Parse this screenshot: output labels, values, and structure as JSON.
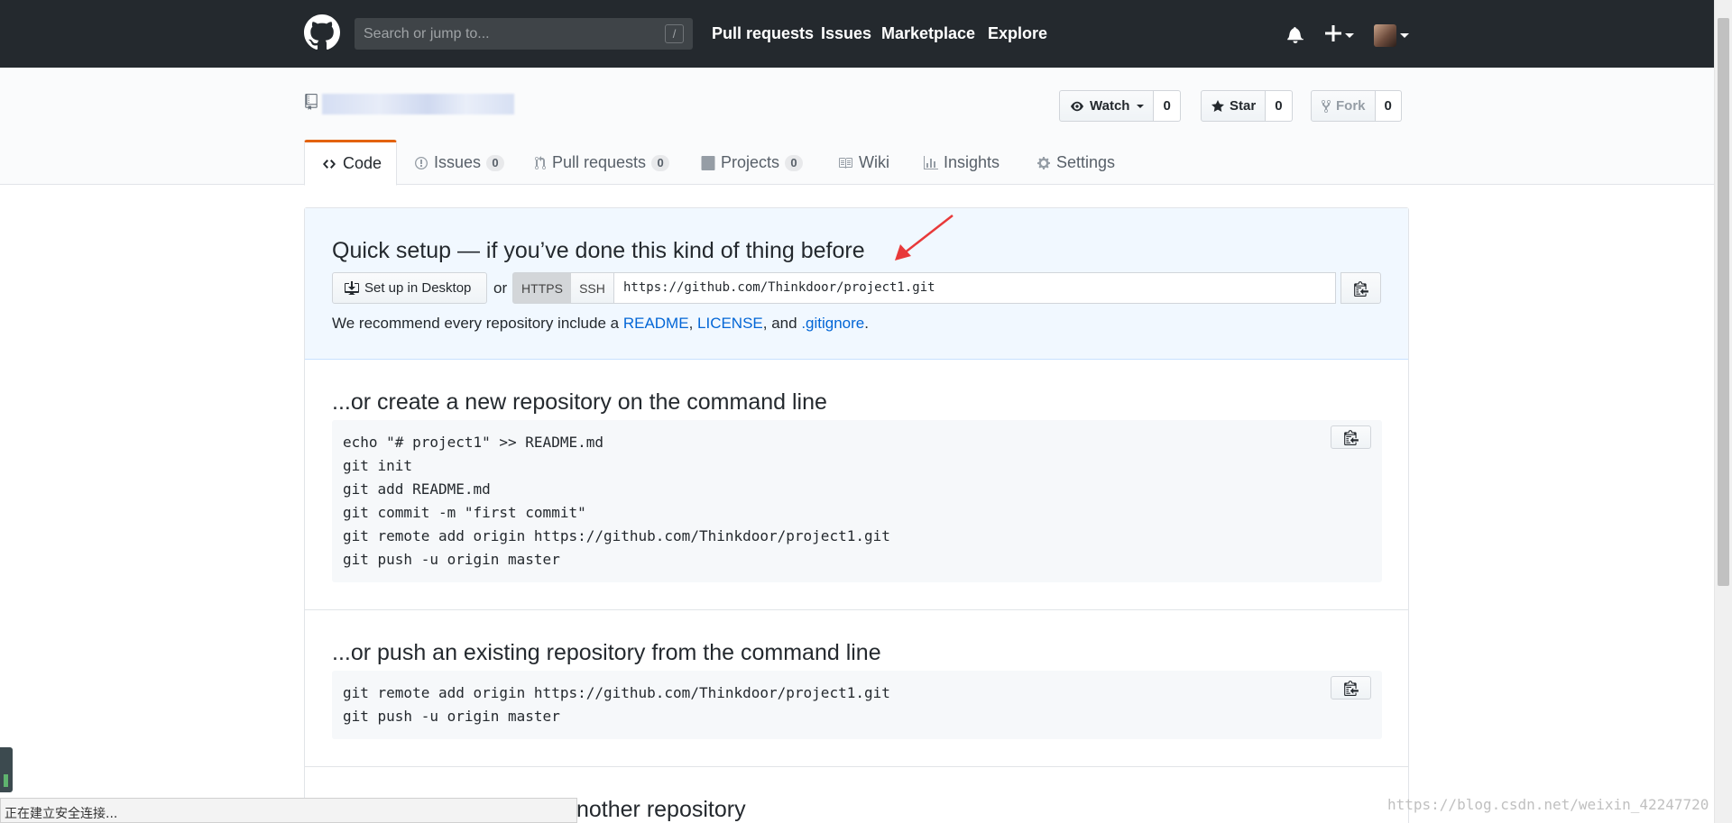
{
  "header": {
    "search_placeholder": "Search or jump to...",
    "search_shortcut": "/",
    "nav": [
      "Pull requests",
      "Issues",
      "Marketplace",
      "Explore"
    ]
  },
  "repo_actions": {
    "watch_label": "Watch",
    "watch_count": "0",
    "star_label": "Star",
    "star_count": "0",
    "fork_label": "Fork",
    "fork_count": "0"
  },
  "tabs": [
    {
      "label": "Code"
    },
    {
      "label": "Issues",
      "count": "0"
    },
    {
      "label": "Pull requests",
      "count": "0"
    },
    {
      "label": "Projects",
      "count": "0"
    },
    {
      "label": "Wiki"
    },
    {
      "label": "Insights"
    },
    {
      "label": "Settings"
    }
  ],
  "quick_setup": {
    "title": "Quick setup — if you’ve done this kind of thing before",
    "desktop_button": "Set up in Desktop",
    "or": "or",
    "https_label": "HTTPS",
    "ssh_label": "SSH",
    "clone_url": "https://github.com/Thinkdoor/project1.git",
    "recommend_prefix": "We recommend every repository include a ",
    "readme_link": "README",
    "comma": ", ",
    "license_link": "LICENSE",
    "and": ", and ",
    "gitignore_link": ".gitignore",
    "period": "."
  },
  "new_repo": {
    "title": "...or create a new repository on the command line",
    "lines": [
      "echo \"# project1\" >> README.md",
      "git init",
      "git add README.md",
      "git commit -m \"first commit\"",
      "git remote add origin https://github.com/Thinkdoor/project1.git",
      "git push -u origin master"
    ]
  },
  "push_existing": {
    "title": "...or push an existing repository from the command line",
    "lines": [
      "git remote add origin https://github.com/Thinkdoor/project1.git",
      "git push -u origin master"
    ]
  },
  "import_partial": {
    "title": "nother repository"
  },
  "status_bar": "正在建立安全连接...",
  "watermark": "https://blog.csdn.net/weixin_42247720",
  "colors": {
    "header_bg": "#24292e",
    "link": "#0366d6",
    "tab_accent": "#e36209",
    "quick_bg": "#f1f8ff",
    "arrow": "#e8393a"
  }
}
